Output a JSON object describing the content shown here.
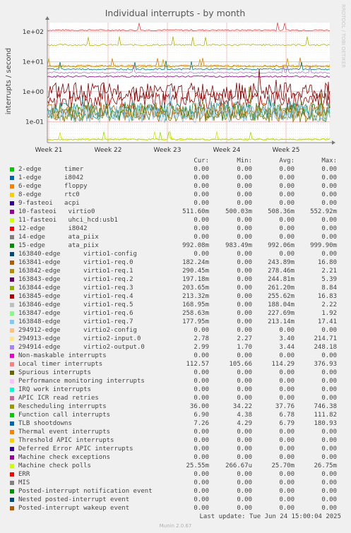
{
  "chart_data": {
    "type": "line",
    "title": "Individual interrupts - by month",
    "ylabel": "interrupts / second",
    "yscale": "log",
    "ylim": [
      0.02,
      200
    ],
    "yticks": [
      "1e+02",
      "1e+01",
      "1e+00",
      "1e-01"
    ],
    "ytick_values": [
      100,
      10,
      1,
      0.1
    ],
    "xticks": [
      "Week 21",
      "Week 22",
      "Week 23",
      "Week 24",
      "Week 25"
    ],
    "grid": true,
    "side_text": "RRDTOOL / TOBI OETIKER",
    "series_levels": [
      {
        "color": "#e24a4a",
        "level": 112
      },
      {
        "color": "#b5b500",
        "level": 36
      },
      {
        "color": "#dd7a00",
        "level": 7.2
      },
      {
        "color": "#d0a000",
        "level": 6.9
      },
      {
        "color": "#007a7a",
        "level": 5.6
      },
      {
        "color": "#b07ad0",
        "level": 4.3
      },
      {
        "color": "#900090",
        "level": 3.2
      },
      {
        "color": "#800000",
        "level": 0.99
      },
      {
        "color": "#a00000",
        "level": 0.51
      },
      {
        "color": "#1aa0a0",
        "level": 0.25
      },
      {
        "color": "#2c8a2c",
        "level": 0.21
      },
      {
        "color": "#7a7a00",
        "level": 0.19
      },
      {
        "color": "#c06000",
        "level": 0.22
      },
      {
        "color": "#80c0e8",
        "level": 0.18
      },
      {
        "color": "#e0e000",
        "level": 0.0255
      },
      {
        "color": "#a0e000",
        "level": 0.0257
      }
    ]
  },
  "legend": {
    "headers": {
      "cur": "Cur:",
      "min": "Min:",
      "avg": "Avg:",
      "max": "Max:"
    },
    "rows": [
      {
        "color": "#00cc00",
        "name": "2-edge      timer",
        "cur": "0.00",
        "min": "0.00",
        "avg": "0.00",
        "max": "0.00"
      },
      {
        "color": "#0066b3",
        "name": "1-edge      i8042",
        "cur": "0.00",
        "min": "0.00",
        "avg": "0.00",
        "max": "0.00"
      },
      {
        "color": "#ff8000",
        "name": "6-edge      floppy",
        "cur": "0.00",
        "min": "0.00",
        "avg": "0.00",
        "max": "0.00"
      },
      {
        "color": "#ffcc00",
        "name": "8-edge      rtc0",
        "cur": "0.00",
        "min": "0.00",
        "avg": "0.00",
        "max": "0.00"
      },
      {
        "color": "#330099",
        "name": "9-fasteoi   acpi",
        "cur": "0.00",
        "min": "0.00",
        "avg": "0.00",
        "max": "0.00"
      },
      {
        "color": "#990099",
        "name": "10-fasteoi   virtio0",
        "cur": "511.60m",
        "min": "500.03m",
        "avg": "508.36m",
        "max": "552.92m"
      },
      {
        "color": "#ccff00",
        "name": "11-fasteoi   uhci_hcd:usb1",
        "cur": "0.00",
        "min": "0.00",
        "avg": "0.00",
        "max": "0.00"
      },
      {
        "color": "#ff0000",
        "name": "12-edge      i8042",
        "cur": "0.00",
        "min": "0.00",
        "avg": "0.00",
        "max": "0.00"
      },
      {
        "color": "#808080",
        "name": "14-edge      ata_piix",
        "cur": "0.00",
        "min": "0.00",
        "avg": "0.00",
        "max": "0.00"
      },
      {
        "color": "#008f00",
        "name": "15-edge      ata_piix",
        "cur": "992.08m",
        "min": "983.49m",
        "avg": "992.06m",
        "max": "999.90m"
      },
      {
        "color": "#00487d",
        "name": "163840-edge      virtio1-config",
        "cur": "0.00",
        "min": "0.00",
        "avg": "0.00",
        "max": "0.00"
      },
      {
        "color": "#b35a00",
        "name": "163841-edge      virtio1-req.0",
        "cur": "182.24m",
        "min": "0.00",
        "avg": "243.89m",
        "max": "16.80"
      },
      {
        "color": "#b38f00",
        "name": "163842-edge      virtio1-req.1",
        "cur": "290.45m",
        "min": "0.00",
        "avg": "278.46m",
        "max": "2.21"
      },
      {
        "color": "#6b006b",
        "name": "163843-edge      virtio1-req.2",
        "cur": "197.18m",
        "min": "0.00",
        "avg": "244.81m",
        "max": "5.39"
      },
      {
        "color": "#8fb300",
        "name": "163844-edge      virtio1-req.3",
        "cur": "203.65m",
        "min": "0.00",
        "avg": "261.20m",
        "max": "8.84"
      },
      {
        "color": "#b30000",
        "name": "163845-edge      virtio1-req.4",
        "cur": "213.32m",
        "min": "0.00",
        "avg": "255.62m",
        "max": "16.83"
      },
      {
        "color": "#bebebe",
        "name": "163846-edge      virtio1-req.5",
        "cur": "168.95m",
        "min": "0.00",
        "avg": "188.04m",
        "max": "2.22"
      },
      {
        "color": "#80ff80",
        "name": "163847-edge      virtio1-req.6",
        "cur": "258.63m",
        "min": "0.00",
        "avg": "227.69m",
        "max": "1.92"
      },
      {
        "color": "#80c9ff",
        "name": "163848-edge      virtio1-req.7",
        "cur": "177.95m",
        "min": "0.00",
        "avg": "213.14m",
        "max": "17.41"
      },
      {
        "color": "#ffc080",
        "name": "294912-edge      virtio2-config",
        "cur": "0.00",
        "min": "0.00",
        "avg": "0.00",
        "max": "0.00"
      },
      {
        "color": "#ffe680",
        "name": "294913-edge      virtio2-input.0",
        "cur": "2.78",
        "min": "2.27",
        "avg": "3.40",
        "max": "214.71"
      },
      {
        "color": "#aa80ff",
        "name": "294914-edge      virtio2-output.0",
        "cur": "2.99",
        "min": "1.70",
        "avg": "3.44",
        "max": "248.18"
      },
      {
        "color": "#ee00cc",
        "name": "Non-maskable interrupts",
        "cur": "0.00",
        "min": "0.00",
        "avg": "0.00",
        "max": "0.00"
      },
      {
        "color": "#ff8080",
        "name": "Local timer interrupts",
        "cur": "112.57",
        "min": "105.66",
        "avg": "114.29",
        "max": "376.93"
      },
      {
        "color": "#666600",
        "name": "Spurious interrupts",
        "cur": "0.00",
        "min": "0.00",
        "avg": "0.00",
        "max": "0.00"
      },
      {
        "color": "#ffbfff",
        "name": "Performance monitoring interrupts",
        "cur": "0.00",
        "min": "0.00",
        "avg": "0.00",
        "max": "0.00"
      },
      {
        "color": "#00ffcc",
        "name": "IRQ work interrupts",
        "cur": "0.00",
        "min": "0.00",
        "avg": "0.00",
        "max": "0.00"
      },
      {
        "color": "#cc6699",
        "name": "APIC ICR read retries",
        "cur": "0.00",
        "min": "0.00",
        "avg": "0.00",
        "max": "0.00"
      },
      {
        "color": "#999900",
        "name": "Rescheduling interrupts",
        "cur": "36.00",
        "min": "34.22",
        "avg": "37.76",
        "max": "746.38"
      },
      {
        "color": "#00cc00",
        "name": "Function call interrupts",
        "cur": "6.90",
        "min": "4.38",
        "avg": "6.78",
        "max": "111.82"
      },
      {
        "color": "#0066b3",
        "name": "TLB shootdowns",
        "cur": "7.26",
        "min": "4.29",
        "avg": "6.79",
        "max": "180.93"
      },
      {
        "color": "#ff8000",
        "name": "Thermal event interrupts",
        "cur": "0.00",
        "min": "0.00",
        "avg": "0.00",
        "max": "0.00"
      },
      {
        "color": "#ffcc00",
        "name": "Threshold APIC interrupts",
        "cur": "0.00",
        "min": "0.00",
        "avg": "0.00",
        "max": "0.00"
      },
      {
        "color": "#330099",
        "name": "Deferred Error APIC interrupts",
        "cur": "0.00",
        "min": "0.00",
        "avg": "0.00",
        "max": "0.00"
      },
      {
        "color": "#990099",
        "name": "Machine check exceptions",
        "cur": "0.00",
        "min": "0.00",
        "avg": "0.00",
        "max": "0.00"
      },
      {
        "color": "#ccff00",
        "name": "Machine check polls",
        "cur": "25.55m",
        "min": "266.67u",
        "avg": "25.70m",
        "max": "26.75m"
      },
      {
        "color": "#ff0000",
        "name": "ERR",
        "cur": "0.00",
        "min": "0.00",
        "avg": "0.00",
        "max": "0.00"
      },
      {
        "color": "#808080",
        "name": "MIS",
        "cur": "0.00",
        "min": "0.00",
        "avg": "0.00",
        "max": "0.00"
      },
      {
        "color": "#008f00",
        "name": "Posted-interrupt notification event",
        "cur": "0.00",
        "min": "0.00",
        "avg": "0.00",
        "max": "0.00"
      },
      {
        "color": "#00487d",
        "name": "Nested posted-interrupt event",
        "cur": "0.00",
        "min": "0.00",
        "avg": "0.00",
        "max": "0.00"
      },
      {
        "color": "#b35a00",
        "name": "Posted-interrupt wakeup event",
        "cur": "0.00",
        "min": "0.00",
        "avg": "0.00",
        "max": "0.00"
      }
    ]
  },
  "footer": {
    "last_update": "Last update: Tue Jun 24 15:00:04 2025",
    "version": "Munin 2.0.67"
  }
}
